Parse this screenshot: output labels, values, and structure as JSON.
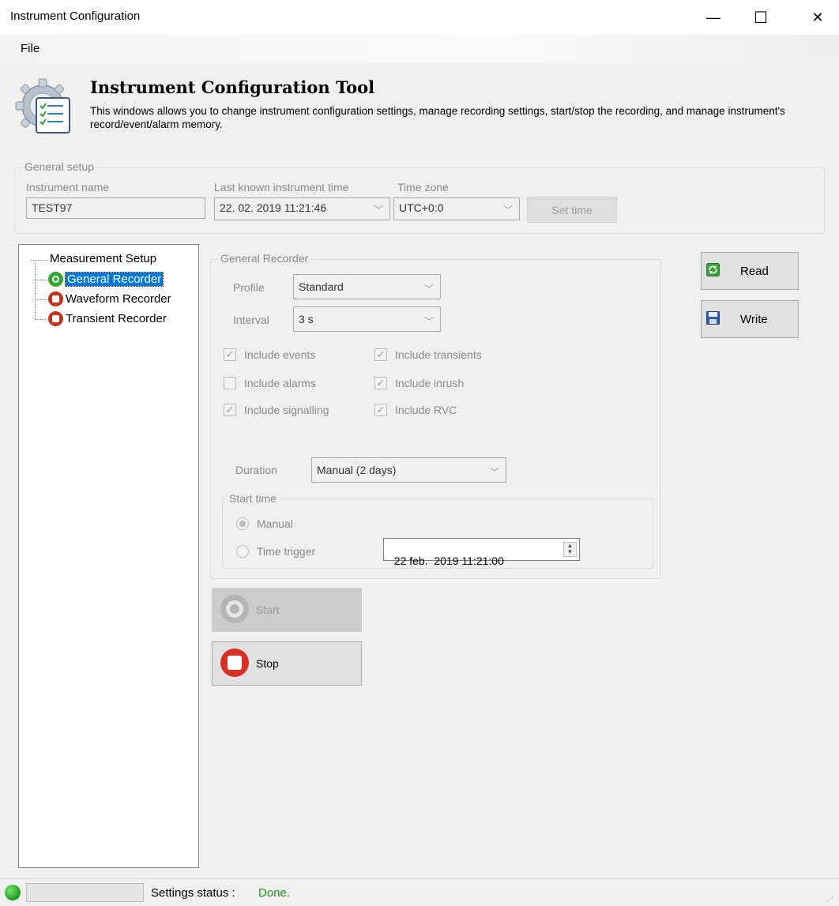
{
  "window": {
    "title": "Instrument Configuration",
    "minimize": "—",
    "maximize": "☐",
    "close": "✕"
  },
  "menu": {
    "file": "File"
  },
  "header": {
    "title": "Instrument Configuration Tool",
    "description": "This windows allows you to change instrument configuration settings, manage recording settings, start/stop the recording, and manage instrument's record/event/alarm memory."
  },
  "general_setup": {
    "legend": "General setup",
    "instrument_name_label": "Instrument name",
    "instrument_name_value": "TEST97",
    "last_time_label": "Last known instrument time",
    "last_time_value": "22. 02. 2019 11:21:46",
    "time_zone_label": "Time zone",
    "time_zone_value": "UTC+0:0",
    "set_time_button": "Set time"
  },
  "tree": {
    "root": "Measurement Setup",
    "items": [
      {
        "label": "General Recorder",
        "status": "running",
        "selected": true
      },
      {
        "label": "Waveform Recorder",
        "status": "stopped",
        "selected": false
      },
      {
        "label": "Transient Recorder",
        "status": "stopped",
        "selected": false
      }
    ]
  },
  "recorder": {
    "legend": "General Recorder",
    "profile_label": "Profile",
    "profile_value": "Standard",
    "interval_label": "Interval",
    "interval_value": "3 s",
    "checkboxes": [
      {
        "label": "Include events",
        "checked": true
      },
      {
        "label": "Include transients",
        "checked": true
      },
      {
        "label": "Include alarms",
        "checked": false
      },
      {
        "label": "Include inrush",
        "checked": true
      },
      {
        "label": "Include signalling",
        "checked": true
      },
      {
        "label": "Include RVC",
        "checked": true
      }
    ],
    "duration_label": "Duration",
    "duration_value": "Manual (2 days)",
    "start_time": {
      "legend": "Start time",
      "manual_label": "Manual",
      "manual_selected": true,
      "trigger_label": "Time trigger",
      "trigger_value": "22 feb.  2019 11:21:00"
    }
  },
  "actions": {
    "start": "Start",
    "stop": "Stop",
    "read": "Read",
    "write": "Write"
  },
  "status": {
    "label": "Settings status :",
    "value": "Done."
  },
  "colors": {
    "status_ok": "#1f8f1f",
    "selection": "#0078d7",
    "running": "#31a72e",
    "stopped": "#c4321c"
  }
}
